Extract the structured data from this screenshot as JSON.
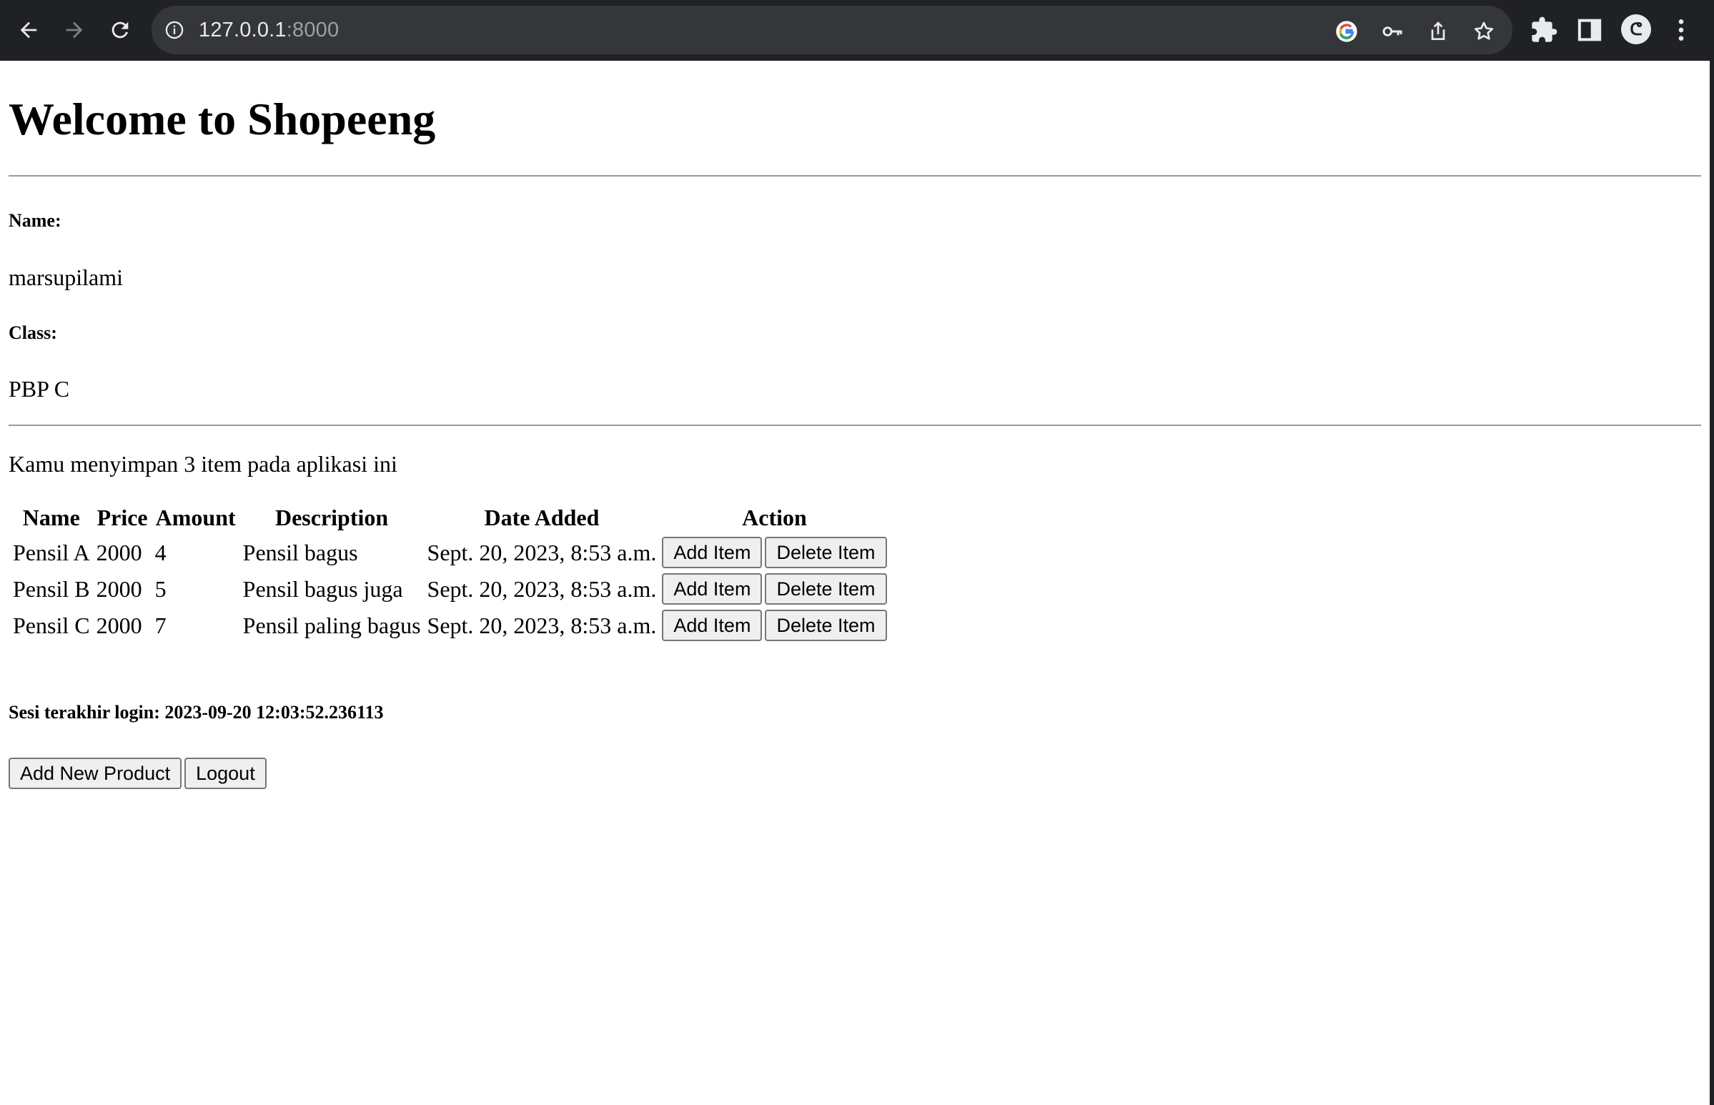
{
  "browser": {
    "url_host": "127.0.0.1",
    "url_port": ":8000",
    "avatar_text": "ᕦ"
  },
  "page": {
    "title": "Welcome to Shopeeng",
    "name_label": "Name:",
    "name_value": "marsupilami",
    "class_label": "Class:",
    "class_value": "PBP C",
    "summary": "Kamu menyimpan 3 item pada aplikasi ini",
    "table": {
      "headers": [
        "Name",
        "Price",
        "Amount",
        "Description",
        "Date Added",
        "Action"
      ],
      "rows": [
        {
          "name": "Pensil A",
          "price": "2000",
          "amount": "4",
          "description": "Pensil bagus",
          "date": "Sept. 20, 2023, 8:53 a.m.",
          "add": "Add Item",
          "delete": "Delete Item"
        },
        {
          "name": "Pensil B",
          "price": "2000",
          "amount": "5",
          "description": "Pensil bagus juga",
          "date": "Sept. 20, 2023, 8:53 a.m.",
          "add": "Add Item",
          "delete": "Delete Item"
        },
        {
          "name": "Pensil C",
          "price": "2000",
          "amount": "7",
          "description": "Pensil paling bagus",
          "date": "Sept. 20, 2023, 8:53 a.m.",
          "add": "Add Item",
          "delete": "Delete Item"
        }
      ]
    },
    "last_login": "Sesi terakhir login: 2023-09-20 12:03:52.236113",
    "add_new_product": "Add New Product",
    "logout": "Logout"
  }
}
